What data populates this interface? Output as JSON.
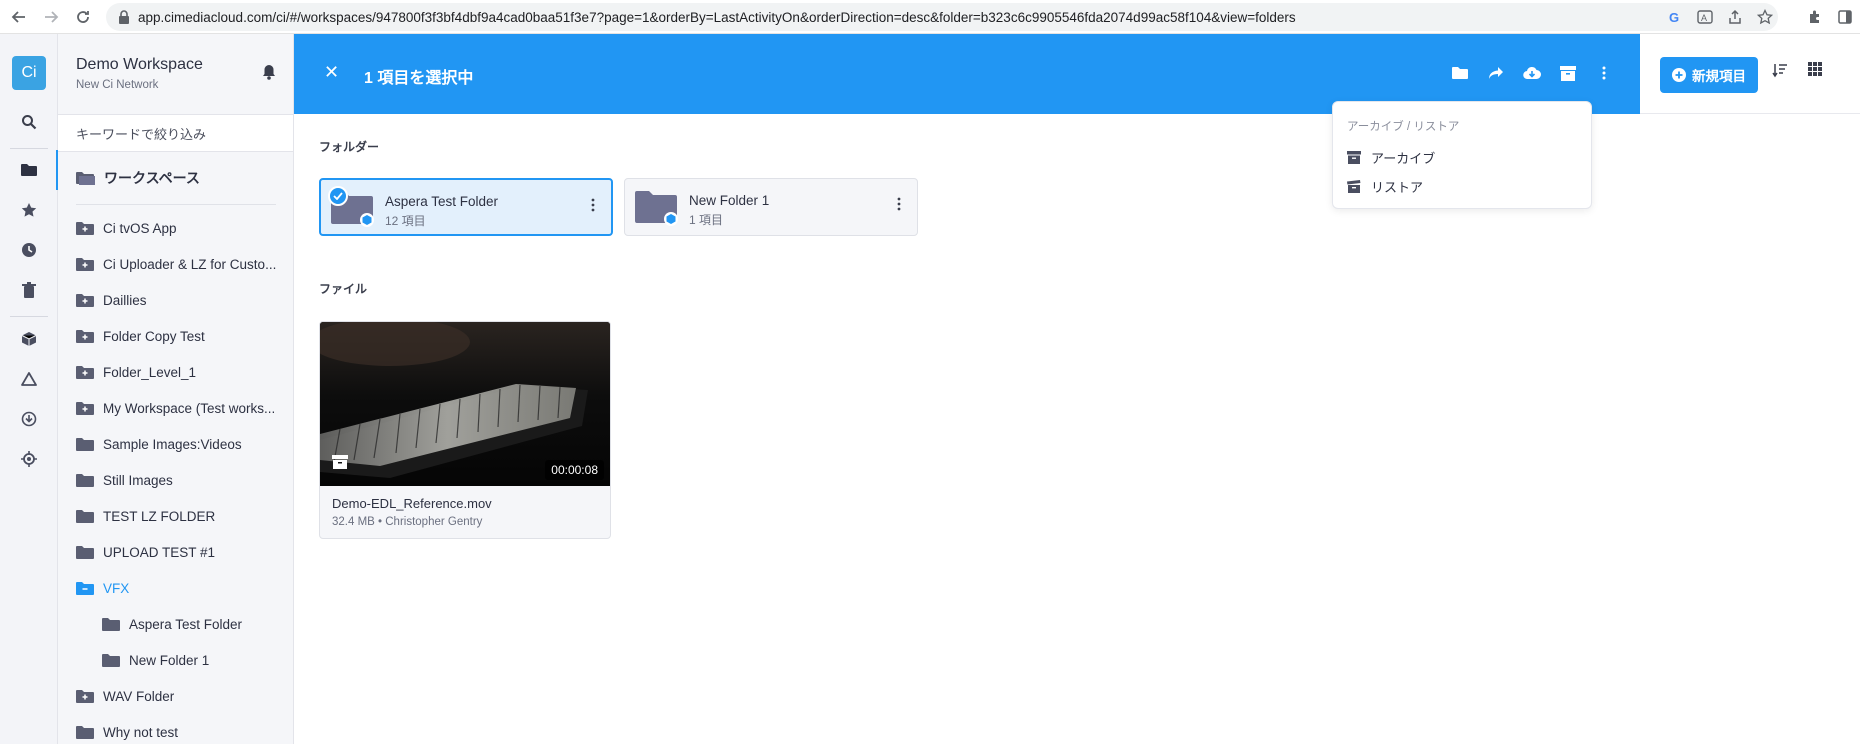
{
  "browser": {
    "url": "app.cimediacloud.com/ci/#/workspaces/947800f3f3bf4dbf9a4cad0baa51f3e7?page=1&orderBy=LastActivityOn&orderDirection=desc&folder=b323c6c9905546fda2074d99ac58f104&view=folders"
  },
  "rail": {
    "logo": "Ci",
    "icons": [
      "search-icon",
      "folder-icon",
      "star-icon",
      "clock-icon",
      "trash-icon",
      "box-icon",
      "cloud-icon",
      "download-icon",
      "target-icon"
    ]
  },
  "sidebar": {
    "workspace_name": "Demo Workspace",
    "network_name": "New Ci Network",
    "filter_placeholder": "キーワードで絞り込み",
    "root_label": "ワークスペース",
    "items": [
      {
        "label": "Ci tvOS App",
        "icon": "folder-plus-icon",
        "level": 0
      },
      {
        "label": "Ci Uploader & LZ for Custo...",
        "icon": "folder-plus-icon",
        "level": 0
      },
      {
        "label": "Daillies",
        "icon": "folder-plus-icon",
        "level": 0
      },
      {
        "label": "Folder Copy Test",
        "icon": "folder-plus-icon",
        "level": 0
      },
      {
        "label": "Folder_Level_1",
        "icon": "folder-plus-icon",
        "level": 0
      },
      {
        "label": "My Workspace (Test works...",
        "icon": "folder-plus-icon",
        "level": 0
      },
      {
        "label": "Sample Images:Videos",
        "icon": "folder-icon",
        "level": 0
      },
      {
        "label": "Still Images",
        "icon": "folder-icon",
        "level": 0
      },
      {
        "label": "TEST LZ FOLDER",
        "icon": "folder-icon",
        "level": 0
      },
      {
        "label": "UPLOAD TEST #1",
        "icon": "folder-icon",
        "level": 0
      },
      {
        "label": "VFX",
        "icon": "folder-minus-icon",
        "level": 0,
        "selected": true
      },
      {
        "label": "Aspera Test Folder",
        "icon": "folder-icon",
        "level": 1
      },
      {
        "label": "New Folder 1",
        "icon": "folder-icon",
        "level": 1
      },
      {
        "label": "WAV Folder",
        "icon": "folder-plus-icon",
        "level": 0
      },
      {
        "label": "Why not test",
        "icon": "folder-icon",
        "level": 0
      }
    ]
  },
  "topbar": {
    "close_label": "✕",
    "selection_text": "1 項目を選択中",
    "actions": [
      "folder-icon",
      "share-icon",
      "cloud-download-icon",
      "archive-icon",
      "more-vertical-icon"
    ]
  },
  "rightbar": {
    "new_item_label": "新規項目",
    "icons": [
      "sort-icon",
      "grid-icon"
    ]
  },
  "main": {
    "folders_title": "フォルダー",
    "files_title": "ファイル",
    "folders": [
      {
        "name": "Aspera Test Folder",
        "count": "12 項目",
        "selected": true
      },
      {
        "name": "New Folder 1",
        "count": "1 項目",
        "selected": false
      }
    ],
    "files": [
      {
        "name": "Demo-EDL_Reference.mov",
        "meta": "32.4 MB • Christopher Gentry",
        "duration": "00:00:08"
      }
    ]
  },
  "dropdown": {
    "header": "アーカイブ / リストア",
    "items": [
      "アーカイブ",
      "リストア"
    ]
  },
  "colors": {
    "accent": "#2196f3",
    "logo_bg": "#3aa3e3",
    "folder_icon": "#6e7191",
    "sidebar_bg": "#f5f6f9"
  }
}
